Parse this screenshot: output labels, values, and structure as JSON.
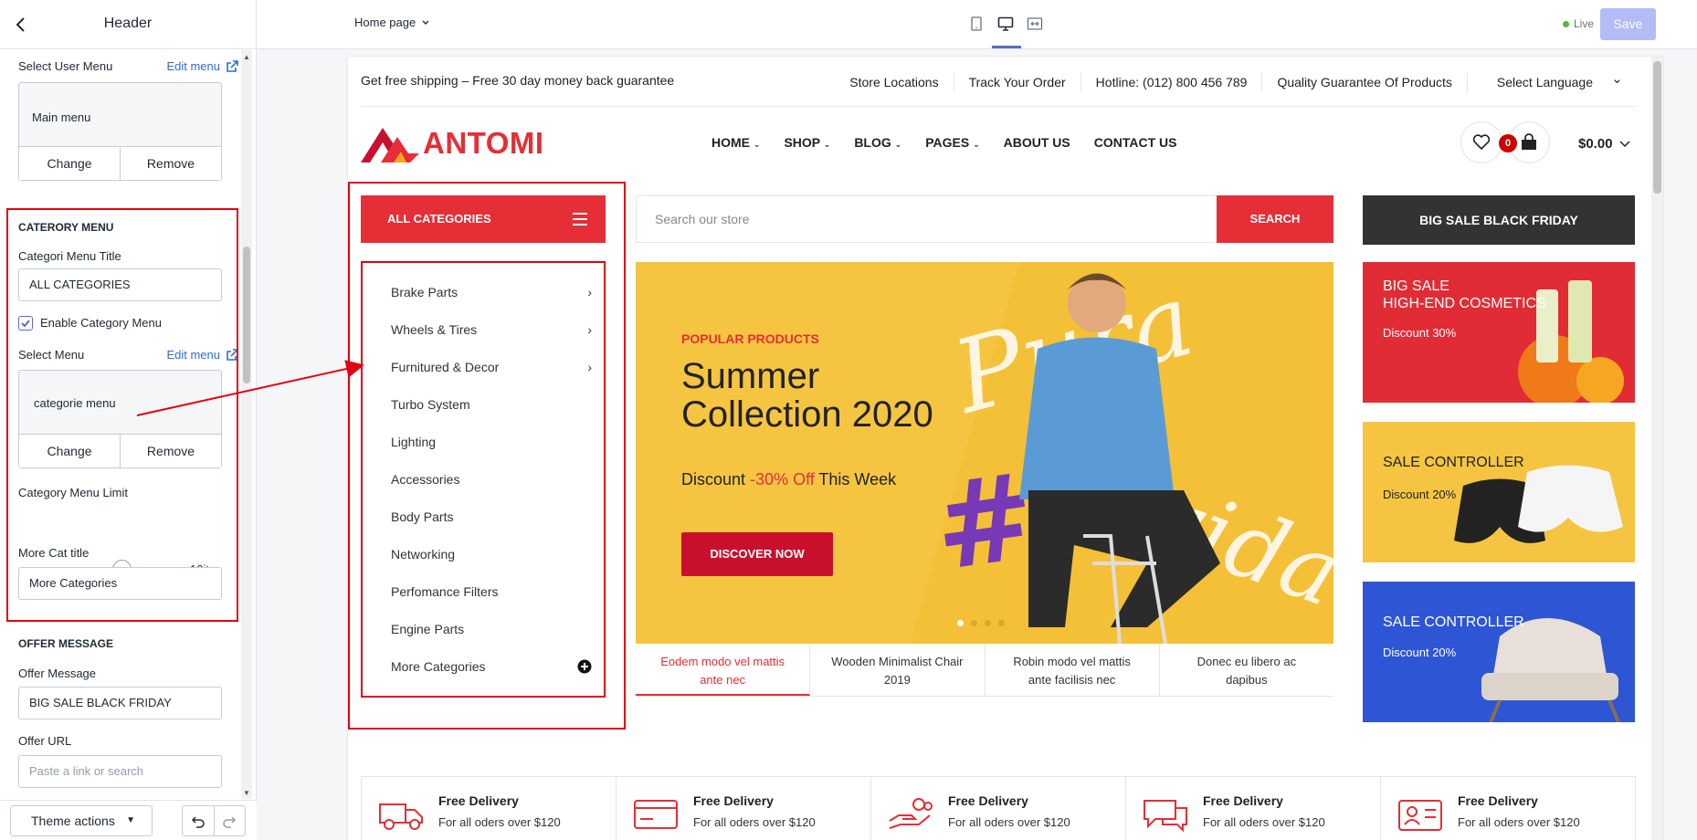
{
  "sidebar": {
    "title": "Header",
    "user_menu": {
      "label": "Select User Menu",
      "edit_link": "Edit menu",
      "menu_name": "Main menu",
      "change": "Change",
      "remove": "Remove"
    },
    "category_section": {
      "title": "CATERORY MENU",
      "title_field_label": "Categori Menu Title",
      "title_field_value": "ALL CATEGORIES",
      "enable_label": "Enable Category Menu",
      "enable_checked": true,
      "select_menu_label": "Select Menu",
      "edit_link": "Edit menu",
      "menu_name": "categorie menu",
      "change": "Change",
      "remove": "Remove",
      "limit_label": "Category Menu Limit",
      "limit_value": "10itm",
      "more_title_label": "More Cat title",
      "more_title_value": "More Categories"
    },
    "offer_section": {
      "title": "OFFER MESSAGE",
      "message_label": "Offer Message",
      "message_value": "BIG SALE BLACK FRIDAY",
      "url_label": "Offer URL",
      "url_placeholder": "Paste a link or search"
    },
    "footer": {
      "theme_actions": "Theme actions"
    }
  },
  "topbar": {
    "page_select": "Home page",
    "status": "Live",
    "save": "Save",
    "accent": "#5c6ac4"
  },
  "store": {
    "promo": "Get free shipping – Free 30 day money back guarantee",
    "top_links": [
      "Store Locations",
      "Track Your Order",
      "Hotline: (012) 800 456 789",
      "Quality Guarantee Of Products",
      "Select Language"
    ],
    "logo": "ANTOMI",
    "nav": [
      "HOME",
      "SHOP",
      "BLOG",
      "PAGES",
      "ABOUT US",
      "CONTACT US"
    ],
    "cart_count": "0",
    "cart_total": "$0.00",
    "all_categories": "ALL CATEGORIES",
    "categories": [
      "Brake Parts",
      "Wheels & Tires",
      "Furnitured & Decor",
      "Turbo System",
      "Lighting",
      "Accessories",
      "Body Parts",
      "Networking",
      "Perfomance Filters",
      "Engine Parts"
    ],
    "more_categories": "More Categories",
    "search_placeholder": "Search our store",
    "search_button": "SEARCH",
    "hero": {
      "subtitle": "POPULAR PRODUCTS",
      "title_line1": "Summer",
      "title_line2": "Collection 2020",
      "discount_pre": "Discount ",
      "discount_value": "-30% Off",
      "discount_post": " This Week",
      "button": "DISCOVER NOW",
      "slide_count": 4,
      "active_slide": 1
    },
    "hero_tabs": [
      {
        "line1": "Eodem modo vel mattis",
        "line2": "ante nec"
      },
      {
        "line1": "Wooden Minimalist Chair",
        "line2": "2019"
      },
      {
        "line1": "Robin modo vel mattis",
        "line2": "ante facilisis nec"
      },
      {
        "line1": "Donec eu libero ac",
        "line2": "dapibus"
      }
    ],
    "offer_banner": "BIG SALE BLACK FRIDAY",
    "banners": [
      {
        "line1": "BIG SALE",
        "line2": "HIGH-END COSMETICS",
        "discount": "Discount 30%",
        "color": "#e22c35"
      },
      {
        "line1": "SALE CONTROLLER",
        "line2": "",
        "discount": "Discount 20%",
        "color": "#f5c542"
      },
      {
        "line1": "SALE CONTROLLER",
        "line2": "",
        "discount": "Discount 20%",
        "color": "#2e55d4"
      }
    ],
    "features": [
      {
        "title": "Free Delivery",
        "desc": "For all oders over $120",
        "icon": "truck-icon"
      },
      {
        "title": "Free Delivery",
        "desc": "For all oders over $120",
        "icon": "credit-card-icon"
      },
      {
        "title": "Free Delivery",
        "desc": "For all oders over $120",
        "icon": "hand-money-icon"
      },
      {
        "title": "Free Delivery",
        "desc": "For all oders over $120",
        "icon": "chat-icon"
      },
      {
        "title": "Free Delivery",
        "desc": "For all oders over $120",
        "icon": "id-card-icon"
      }
    ],
    "brand_color": "#e52e35"
  }
}
